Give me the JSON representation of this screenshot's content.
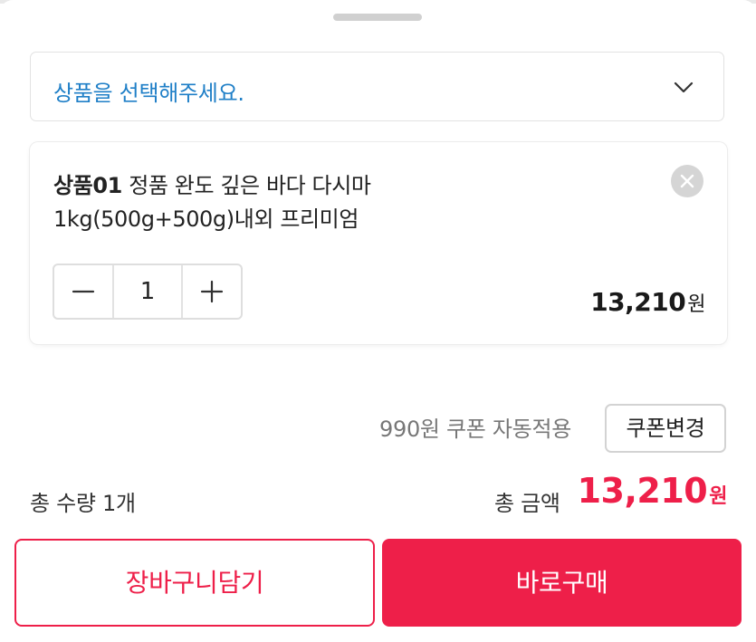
{
  "option_select": {
    "placeholder": "상품을 선택해주세요.",
    "accent_color": "#1f7fc7"
  },
  "selected_item": {
    "prefix": "상품01",
    "name": "정품 완도 깊은 바다 다시마",
    "name_line2": "1kg(500g+500g)내외 프리미엄",
    "quantity": "1",
    "price": "13,210",
    "price_unit": "원"
  },
  "coupon": {
    "text": "990원 쿠폰 자동적용",
    "button_label": "쿠폰변경"
  },
  "summary": {
    "total_quantity": "총 수량 1개",
    "total_label": "총 금액",
    "total_amount": "13,210",
    "total_unit": "원",
    "accent_color": "#ee1f49"
  },
  "actions": {
    "cart_label": "장바구니담기",
    "buy_label": "바로구매"
  },
  "icons": [
    "chevron-down-icon",
    "close-icon",
    "minus-icon",
    "plus-icon"
  ]
}
